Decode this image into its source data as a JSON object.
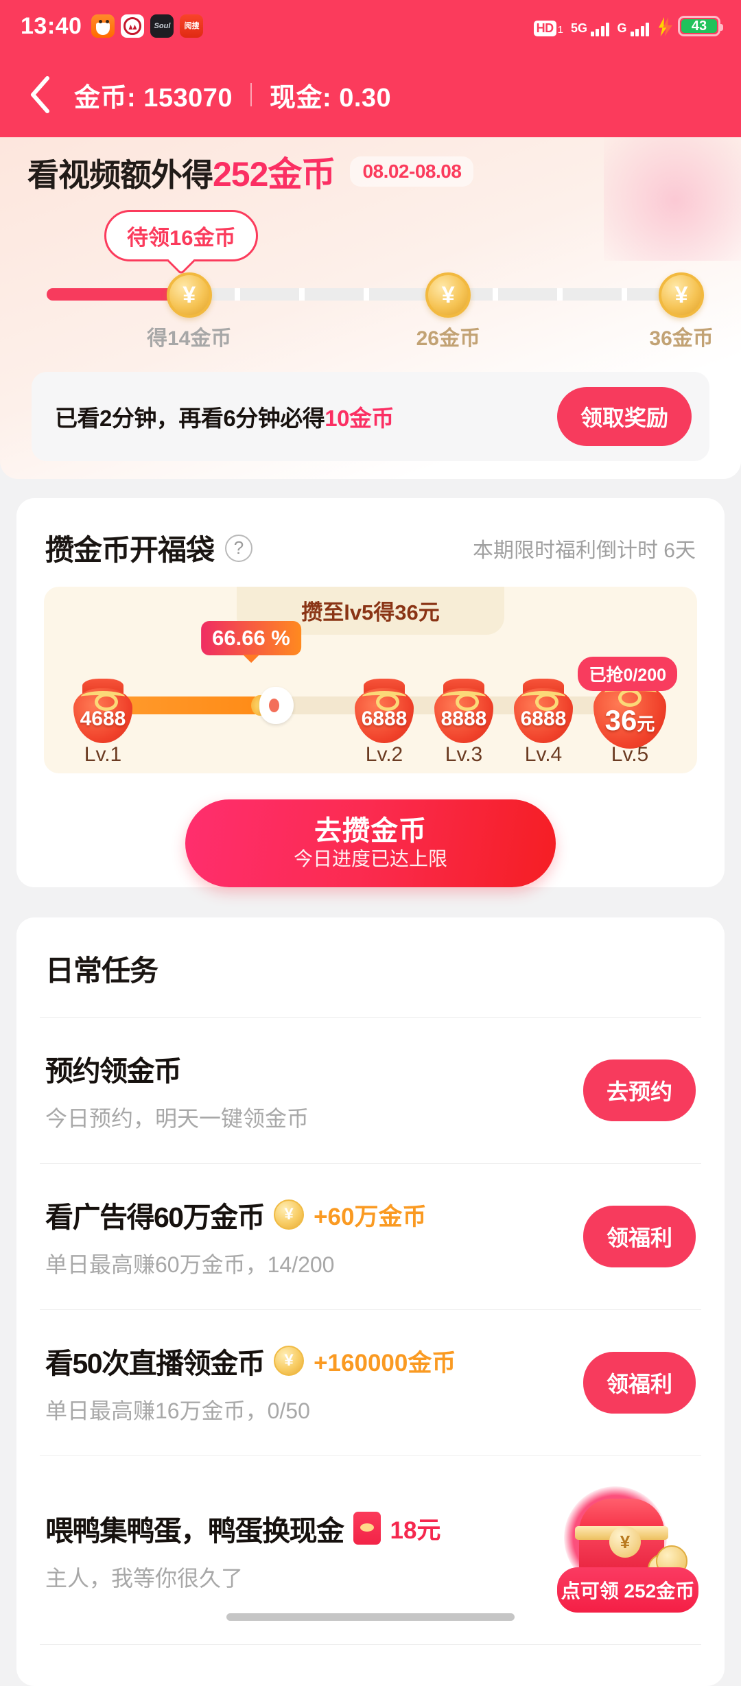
{
  "status_bar": {
    "time": "13:40",
    "apps": [
      "fox-app-icon",
      "circle-logo-app-icon",
      "soul-app-icon",
      "red-app-icon"
    ],
    "soul_label": "Soul",
    "red_label": "阅搜",
    "hd_label": "HD",
    "hd_sub": "1",
    "sim1_label": "5G",
    "sim2_label": "G",
    "battery_level": "43",
    "charging": true
  },
  "header": {
    "back_icon": "chevron-left-icon",
    "coins_label": "金币: 153070",
    "cash_label": "现金: 0.30",
    "accent": "#fb3b5c"
  },
  "video_banner": {
    "title_prefix": "看视频额外得",
    "title_highlight": "252金币",
    "date_range": "08.02-08.08",
    "bubble": "待领16金币",
    "progress_percent": 22,
    "milestones": [
      {
        "label": "得14金币",
        "position": 22,
        "color": "#a7a7a7",
        "reached": true
      },
      {
        "label": "26金币",
        "position": 62,
        "color": "#c2a274",
        "reached": false
      },
      {
        "label": "36金币",
        "position": 98,
        "color": "#c2a274",
        "reached": false
      }
    ],
    "watch_text_prefix": "已看2分钟，再看6分钟必得",
    "watch_text_highlight": "10金币",
    "claim_button": "领取奖励"
  },
  "lucky_bag": {
    "title": "攒金币开福袋",
    "help_icon": "question-mark-icon",
    "countdown": "本期限时福利倒计时 6天",
    "ribbon": "攒至lv5得36元",
    "percent": "66.66 %",
    "progress_percent": 66.66,
    "grab_badge": "已抢0/200",
    "levels": [
      {
        "value": "4688",
        "unit": "",
        "label": "Lv.1"
      },
      {
        "value": "6888",
        "unit": "",
        "label": "Lv.2"
      },
      {
        "value": "8888",
        "unit": "",
        "label": "Lv.3"
      },
      {
        "value": "6888",
        "unit": "",
        "label": "Lv.4"
      },
      {
        "value": "36",
        "unit": "元",
        "label": "Lv.5"
      }
    ],
    "cta_main": "去攒金币",
    "cta_sub": "今日进度已达上限"
  },
  "daily_tasks": {
    "section_title": "日常任务",
    "tasks": [
      {
        "name": "预约领金币",
        "reward": "",
        "reward_icon": "",
        "sub": "今日预约，明天一键领金币",
        "button": "去预约"
      },
      {
        "name": "看广告得60万金币",
        "reward": "+60万金币",
        "reward_icon": "coin-icon",
        "sub": "单日最高赚60万金币，14/200",
        "button": "领福利"
      },
      {
        "name": "看50次直播领金币",
        "reward": "+160000金币",
        "reward_icon": "coin-icon",
        "sub": "单日最高赚16万金币，0/50",
        "button": "领福利"
      },
      {
        "name": "喂鸭集鸭蛋，鸭蛋换现金",
        "reward": "18元",
        "reward_icon": "red-packet-icon",
        "sub": "主人，我等你很久了",
        "button": "",
        "chest_badge": "点可领 252金币"
      }
    ]
  }
}
